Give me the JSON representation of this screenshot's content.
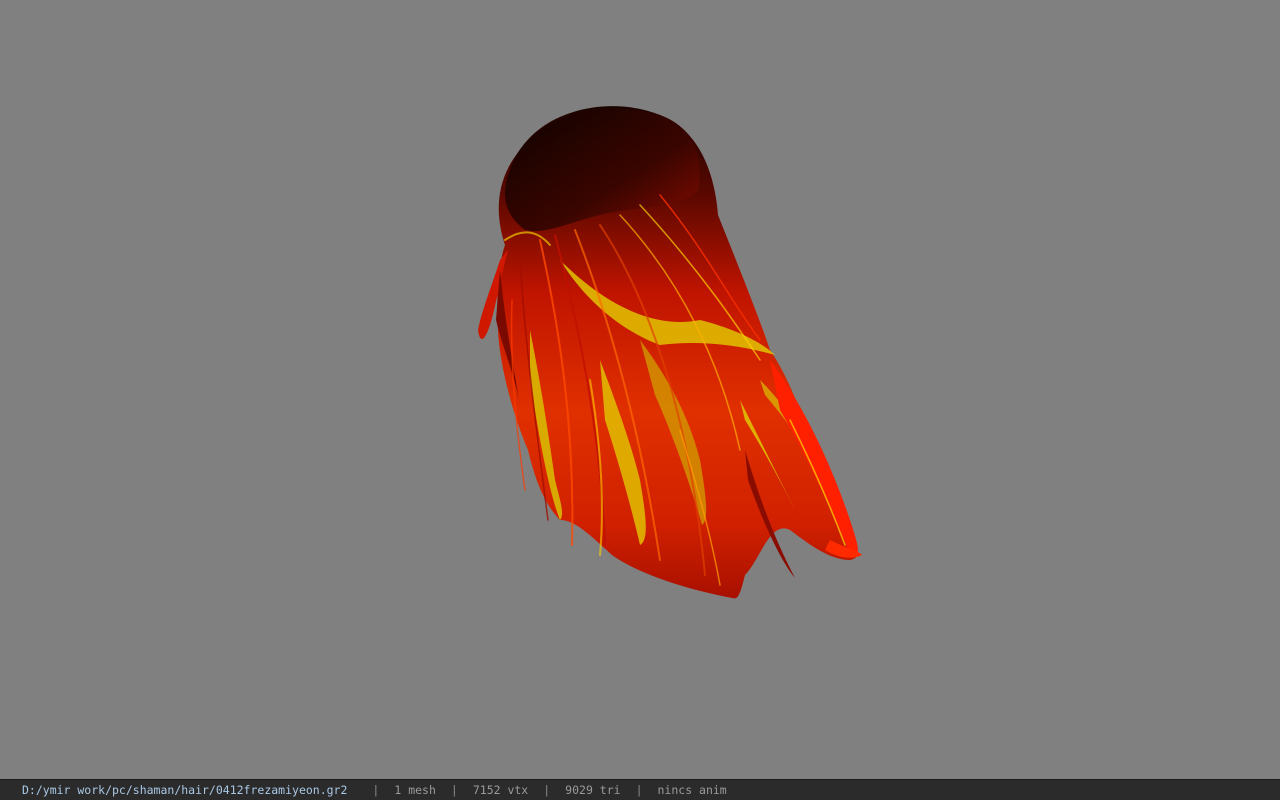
{
  "viewport": {
    "background": "#808080",
    "model": {
      "icon": "hair-mesh-render",
      "colors": {
        "root": "#1a0400",
        "dark_red": "#5a0800",
        "red": "#d01800",
        "orange": "#ff5a00",
        "yellow": "#d8c000"
      }
    }
  },
  "statusbar": {
    "file_path": "D:/ymir work/pc/shaman/hair/0412frezamiyeon.gr2",
    "separator": "|",
    "mesh_count": "1 mesh",
    "vertex_count": "7152 vtx",
    "triangle_count": "9029 tri",
    "anim_status": "nincs anim"
  }
}
